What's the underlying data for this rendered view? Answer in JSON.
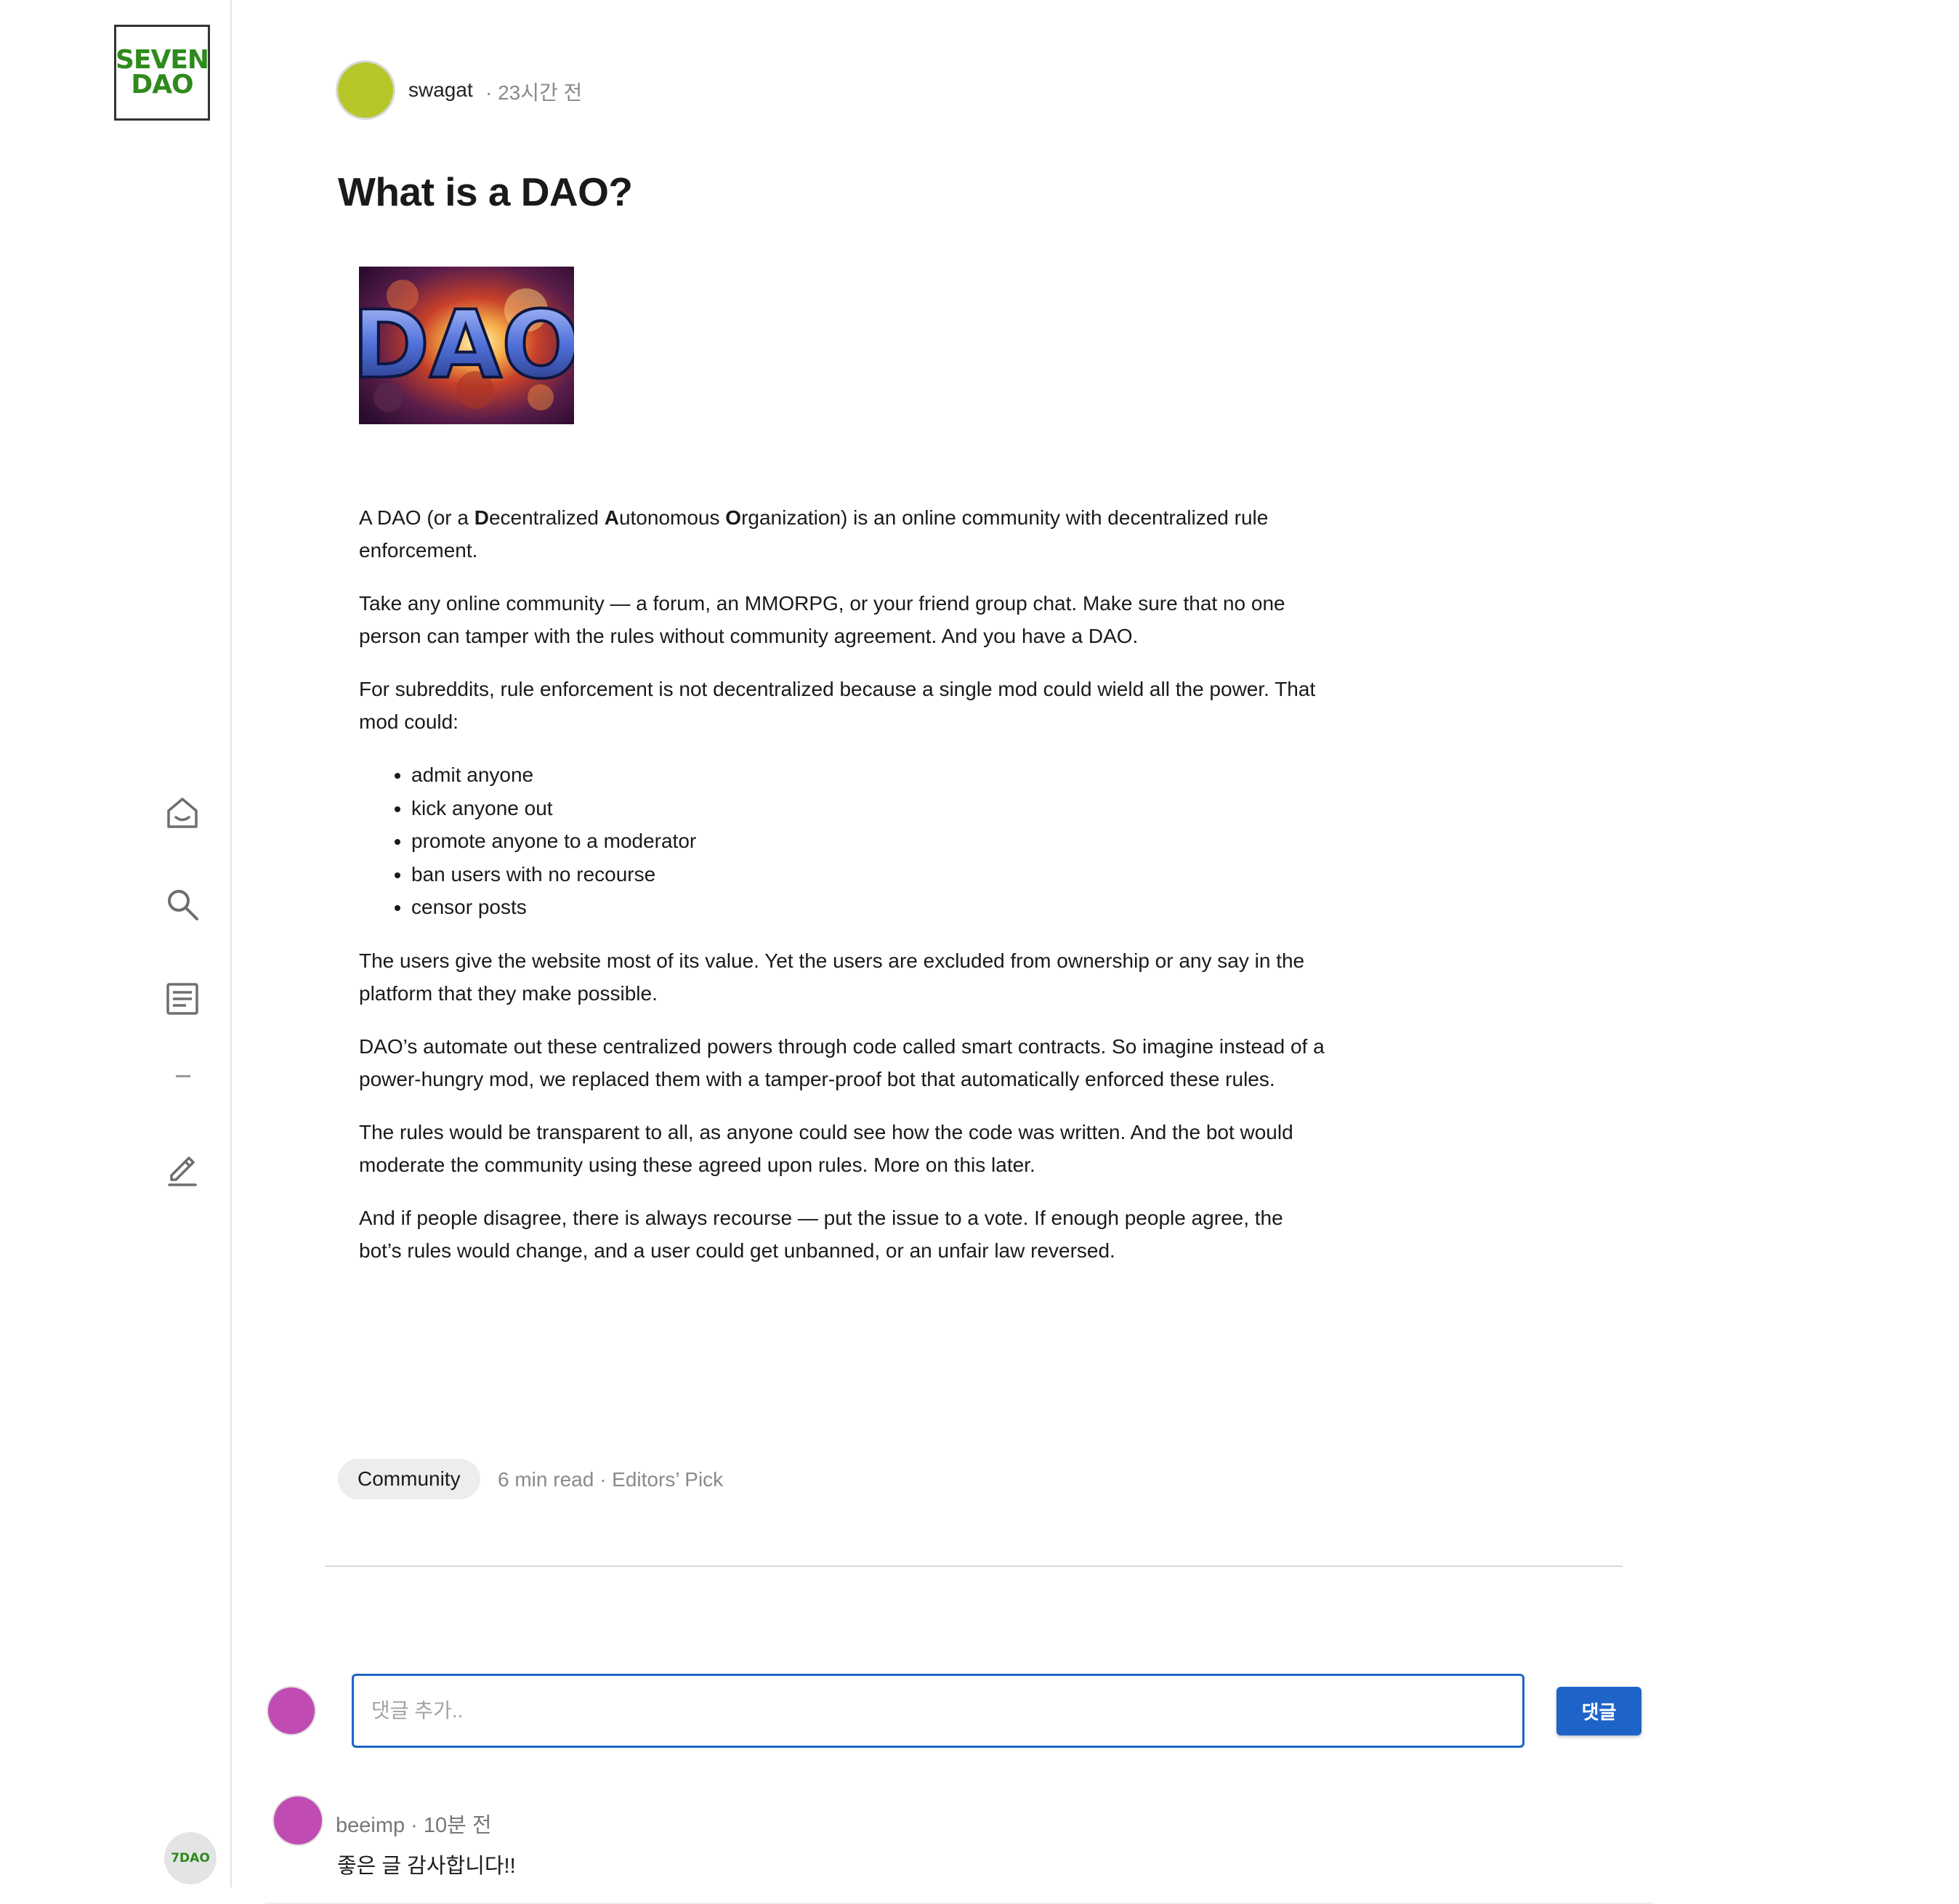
{
  "sidebar": {
    "logo_line1": "SEVEN",
    "logo_line2": "DAO",
    "nav": [
      {
        "icon": "home-icon"
      },
      {
        "icon": "search-icon"
      },
      {
        "icon": "article-icon"
      },
      {
        "icon": "dash-icon"
      },
      {
        "icon": "pen-icon"
      }
    ],
    "user_badge": "7DAO"
  },
  "post": {
    "author": "swagat",
    "time": "· 23시간 전",
    "title": "What is a DAO?",
    "image_text": "DAO",
    "p1": {
      "t1": "A DAO (or a ",
      "b1": "D",
      "t2": "ecentralized ",
      "b2": "A",
      "t3": "utonomous ",
      "b3": "O",
      "t4": "rganization) is an online community with decentralized rule enforcement."
    },
    "p2": "Take any online community — a forum, an MMORPG, or your friend group chat. Make sure that no one person can tamper with the rules without community agreement. And you have a DAO.",
    "p3": "For subreddits, rule enforcement is not decentralized because a single mod could wield all the power. That mod could:",
    "bullets": [
      "admit anyone",
      "kick anyone out",
      "promote anyone to a moderator",
      "ban users with no recourse",
      "censor posts"
    ],
    "p4": "The users give the website most of its value. Yet the users are excluded from ownership or any say in the platform that they make possible.",
    "p5": "DAO’s automate out these centralized powers through code called smart contracts. So imagine instead of a power-hungry mod, we replaced them with a tamper-proof bot that automatically enforced these rules.",
    "p6": "The rules would be transparent to all, as anyone could see how the code was written. And the bot would moderate the community using these agreed upon rules. More on this later.",
    "p7": "And if people disagree, there is always recourse — put the issue to a vote. If enough people agree, the bot’s rules would change, and a user could get unbanned, or an unfair law reversed.",
    "tag": "Community",
    "meta": "6 min read · Editors’ Pick"
  },
  "comment_form": {
    "placeholder": "댓글 추가..",
    "button": "댓글"
  },
  "comments": [
    {
      "author": "beeimp · 10분 전",
      "text": "좋은 글 감사합니다!!"
    }
  ],
  "colors": {
    "logo_green": "#2e8a1c",
    "author_avatar": "#b7c72a",
    "user_avatar": "#c04bb2",
    "accent_blue": "#1e64c8"
  }
}
